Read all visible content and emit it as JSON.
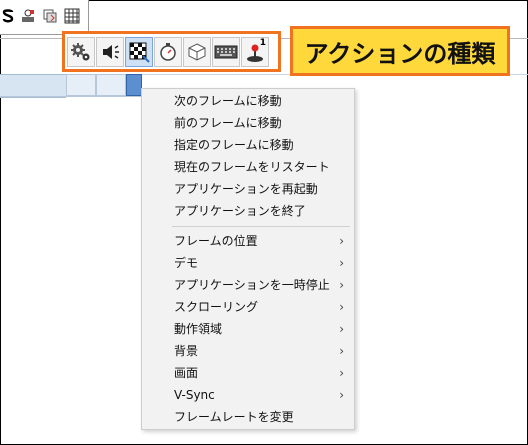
{
  "toolbar": {
    "icons": [
      "bold-s-icon",
      "stamp-icon",
      "layers-icon",
      "table-grid-icon"
    ]
  },
  "action_bar": {
    "icons": [
      "gear-icon",
      "speaker-icon",
      "checker-frame-icon",
      "stopwatch-icon",
      "box-icon",
      "keyboard-icon",
      "joystick-icon"
    ],
    "joystick_badge": "1"
  },
  "callout": {
    "text": "アクションの種類"
  },
  "context_menu": {
    "group1": [
      "次のフレームに移動",
      "前のフレームに移動",
      "指定のフレームに移動",
      "現在のフレームをリスタート",
      "アプリケーションを再起動",
      "アプリケーションを終了"
    ],
    "group2": [
      {
        "label": "フレームの位置",
        "submenu": true
      },
      {
        "label": "デモ",
        "submenu": true
      },
      {
        "label": "アプリケーションを一時停止",
        "submenu": true
      },
      {
        "label": "スクローリング",
        "submenu": true
      },
      {
        "label": "動作領域",
        "submenu": true
      },
      {
        "label": "背景",
        "submenu": true
      },
      {
        "label": "画面",
        "submenu": true
      },
      {
        "label": "V-Sync",
        "submenu": true
      },
      {
        "label": "フレームレートを変更",
        "submenu": false
      }
    ],
    "submenu_arrow": "›"
  },
  "colors": {
    "highlight_border": "#f0731f",
    "callout_fill": "#ffd83b",
    "selected_cell": "#5b8fd0"
  }
}
